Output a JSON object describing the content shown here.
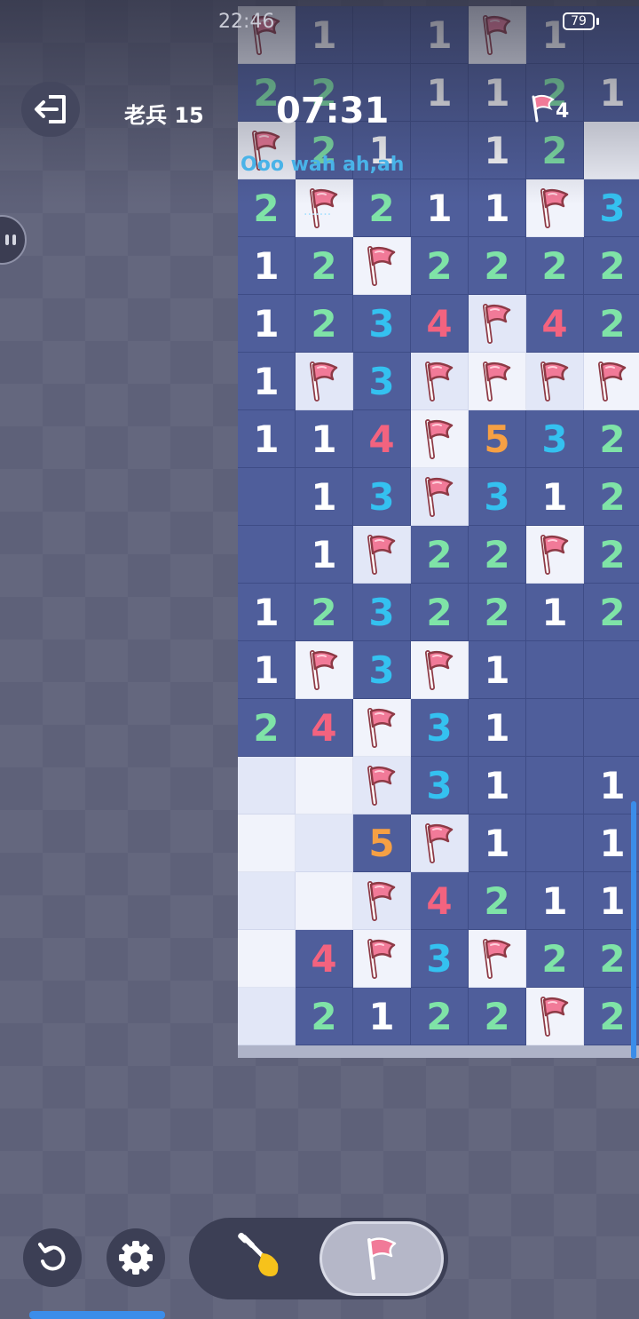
{
  "status_bar": {
    "time": "22:46",
    "battery": "79"
  },
  "header": {
    "player_name": "老兵 15",
    "timer": "07:31",
    "flags_remaining": "4"
  },
  "chat": {
    "message": "Ooo wah ah,ah",
    "typing": "......."
  },
  "icons": {
    "exit": "exit-icon",
    "restart": "restart-icon",
    "settings": "gear-icon",
    "dig": "shovel-icon",
    "flag": "flag-icon"
  },
  "colors": {
    "open_cell": "#4f5e9b",
    "hidden_light": "#f1f3fb",
    "hidden_blue": "#e2e7f7",
    "number_1": "#ffffff",
    "number_2": "#7fe3a7",
    "number_3": "#34c1f0",
    "number_4": "#f3637f",
    "number_5": "#f6a044",
    "flag": "#f17a98",
    "accent": "#3b8de9"
  },
  "board": {
    "columns": 7,
    "rows": [
      [
        "F",
        "1",
        "",
        "1",
        "F",
        "1",
        ""
      ],
      [
        "2",
        "2",
        "",
        "1",
        "1",
        "2",
        "1"
      ],
      [
        "F",
        "2",
        "1",
        "",
        "1",
        "2",
        "H"
      ],
      [
        "2",
        "F",
        "2",
        "1",
        "1",
        "F",
        "3"
      ],
      [
        "1",
        "2",
        "F",
        "2",
        "2",
        "2",
        "2"
      ],
      [
        "1",
        "2",
        "3",
        "4",
        "F",
        "4",
        "2"
      ],
      [
        "1",
        "F",
        "3",
        "F",
        "F",
        "F",
        "F"
      ],
      [
        "1",
        "1",
        "4",
        "F",
        "5",
        "3",
        "2"
      ],
      [
        "",
        "1",
        "3",
        "F",
        "3",
        "1",
        "2"
      ],
      [
        "",
        "1",
        "F",
        "2",
        "2",
        "F",
        "2"
      ],
      [
        "1",
        "2",
        "3",
        "2",
        "2",
        "1",
        "2"
      ],
      [
        "1",
        "F",
        "3",
        "F",
        "1",
        "",
        ""
      ],
      [
        "2",
        "4",
        "F",
        "3",
        "1",
        "",
        ""
      ],
      [
        "H",
        "H",
        "F",
        "3",
        "1",
        "",
        "1"
      ],
      [
        "H",
        "H",
        "5",
        "F",
        "1",
        "",
        "1"
      ],
      [
        "H",
        "H",
        "F",
        "4",
        "2",
        "1",
        "1"
      ],
      [
        "H",
        "4",
        "F",
        "3",
        "F",
        "2",
        "2"
      ],
      [
        "H",
        "2",
        "1",
        "2",
        "2",
        "F",
        "2"
      ]
    ]
  }
}
